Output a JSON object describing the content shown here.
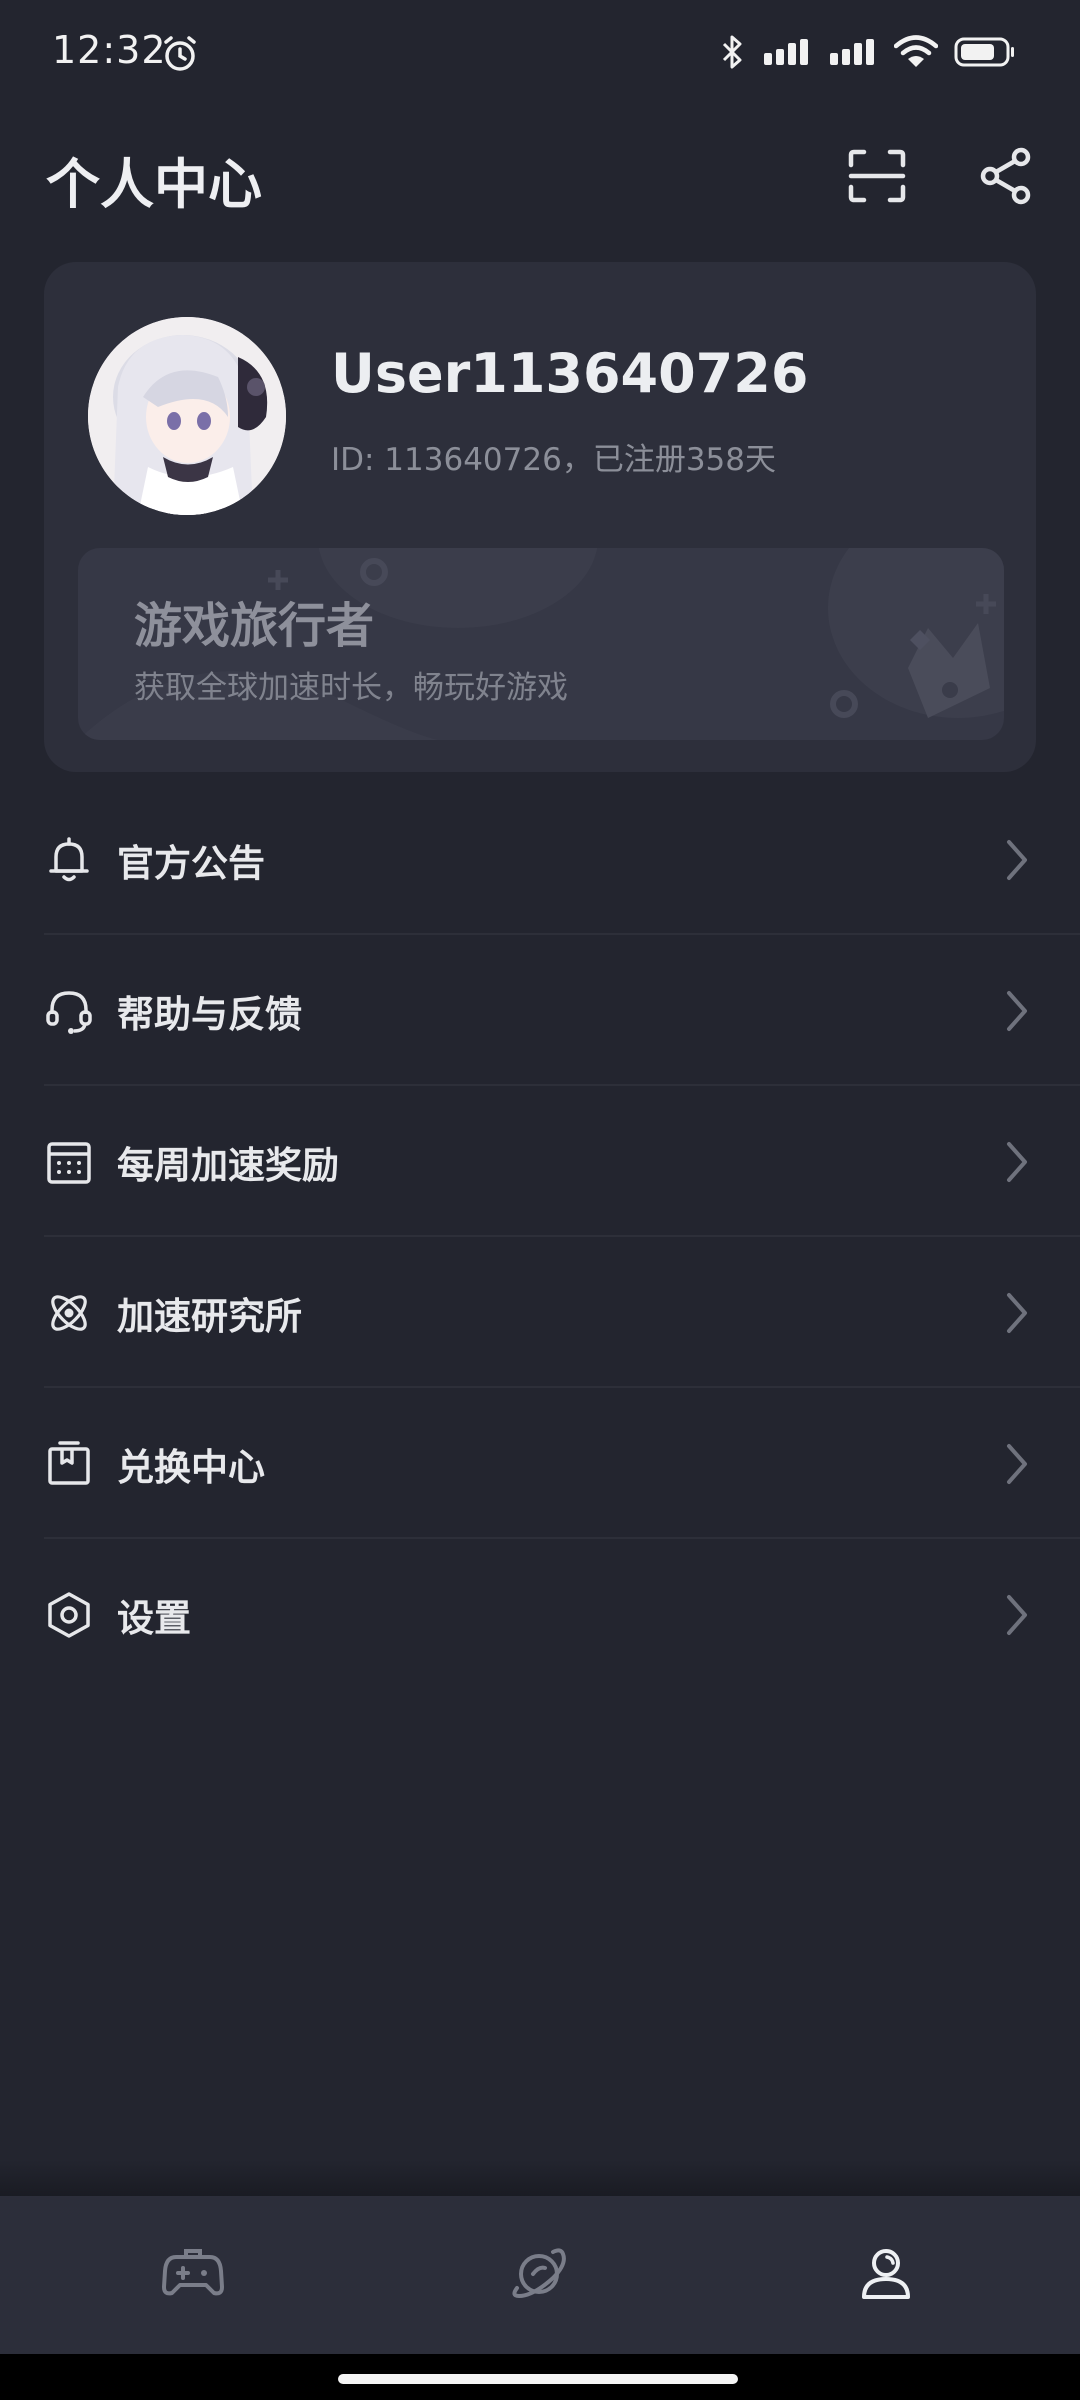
{
  "status_bar": {
    "time": "12:32",
    "battery_level": 0.7
  },
  "header": {
    "title": "个人中心"
  },
  "profile": {
    "username": "User113640726",
    "id_line": "ID: 113640726，已注册358天"
  },
  "vip_banner": {
    "title": "游戏旅行者",
    "subtitle": "获取全球加速时长，畅玩好游戏"
  },
  "menu": {
    "items": [
      {
        "label": "官方公告",
        "icon": "bell-icon"
      },
      {
        "label": "帮助与反馈",
        "icon": "headset-icon"
      },
      {
        "label": "每周加速奖励",
        "icon": "calendar-icon"
      },
      {
        "label": "加速研究所",
        "icon": "atom-icon"
      },
      {
        "label": "兑换中心",
        "icon": "gift-box-icon"
      },
      {
        "label": "设置",
        "icon": "settings-hexagon-icon"
      }
    ]
  },
  "bottom_nav": {
    "items": [
      {
        "icon": "gamepad-icon",
        "active": false
      },
      {
        "icon": "planet-icon",
        "active": false
      },
      {
        "icon": "user-icon",
        "active": true
      }
    ]
  },
  "colors": {
    "background": "#23252f",
    "card": "#2d2f3b",
    "banner": "#363846",
    "text_primary": "#e8e9ec",
    "text_secondary": "#8c8f99",
    "nav_bar": "#2c2e3a"
  }
}
